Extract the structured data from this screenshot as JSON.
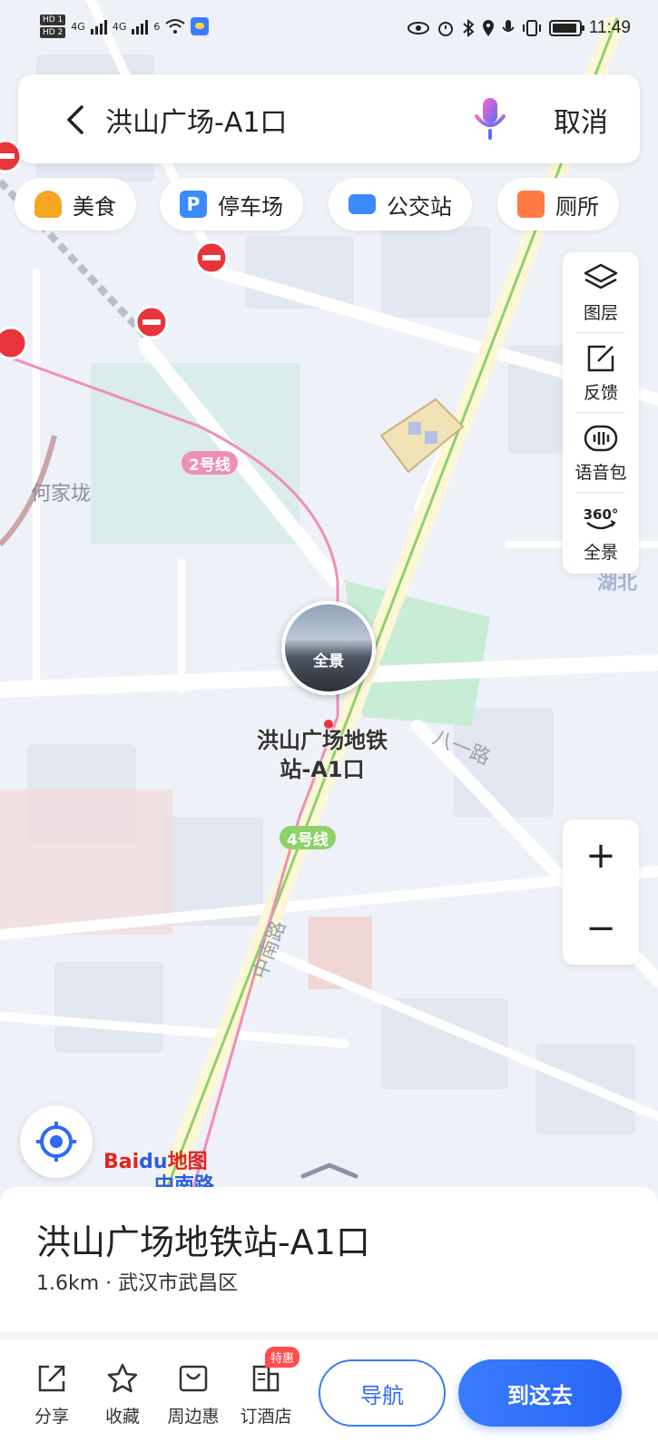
{
  "status_bar": {
    "network_labels": [
      "HD 1",
      "HD 2"
    ],
    "gen_1": "4G",
    "gen_2": "4G",
    "gen_3": "6",
    "time": "11:49"
  },
  "search": {
    "query": "洪山广场-A1口",
    "cancel_label": "取消"
  },
  "categories": [
    {
      "label": "美食",
      "icon": "food-icon",
      "color": "#f5a623"
    },
    {
      "label": "停车场",
      "icon": "parking-icon",
      "color": "#3b8bff"
    },
    {
      "label": "公交站",
      "icon": "bus-stop-icon",
      "color": "#3b8bff"
    },
    {
      "label": "厕所",
      "icon": "toilet-icon",
      "color": "#ff7a45"
    }
  ],
  "tools": [
    {
      "label": "图层",
      "icon": "layers-icon"
    },
    {
      "label": "反馈",
      "icon": "feedback-icon"
    },
    {
      "label": "语音包",
      "icon": "voice-pack-icon"
    },
    {
      "label": "全景",
      "icon": "panorama-360-icon"
    }
  ],
  "zoom": {
    "in": "+",
    "out": "−"
  },
  "map": {
    "labels": {
      "hejialong": "何家垅",
      "hubei": "湖北",
      "bayi_road": "八一路",
      "zhongnan_road": "中南路",
      "zhongnan_station": "中南路"
    },
    "line_tags": {
      "line2": "2号线",
      "line4": "4号线"
    },
    "pin_label": "洪山广场地铁站-A1口",
    "pano_label": "全景",
    "line2_color": "#f08fb4",
    "line4_color": "#8fd16b"
  },
  "logo": {
    "part1": "Bai",
    "part2": "du",
    "part3": "地图"
  },
  "place": {
    "title": "洪山广场地铁站-A1口",
    "distance": "1.6km",
    "separator": "·",
    "area": "武汉市武昌区"
  },
  "actions": [
    {
      "label": "分享",
      "icon": "share-icon"
    },
    {
      "label": "收藏",
      "icon": "star-icon"
    },
    {
      "label": "周边惠",
      "icon": "nearby-deals-icon"
    },
    {
      "label": "订酒店",
      "icon": "hotel-icon"
    }
  ],
  "hotel_badge": "特惠",
  "buttons": {
    "navigate": "导航",
    "go_here": "到这去"
  }
}
